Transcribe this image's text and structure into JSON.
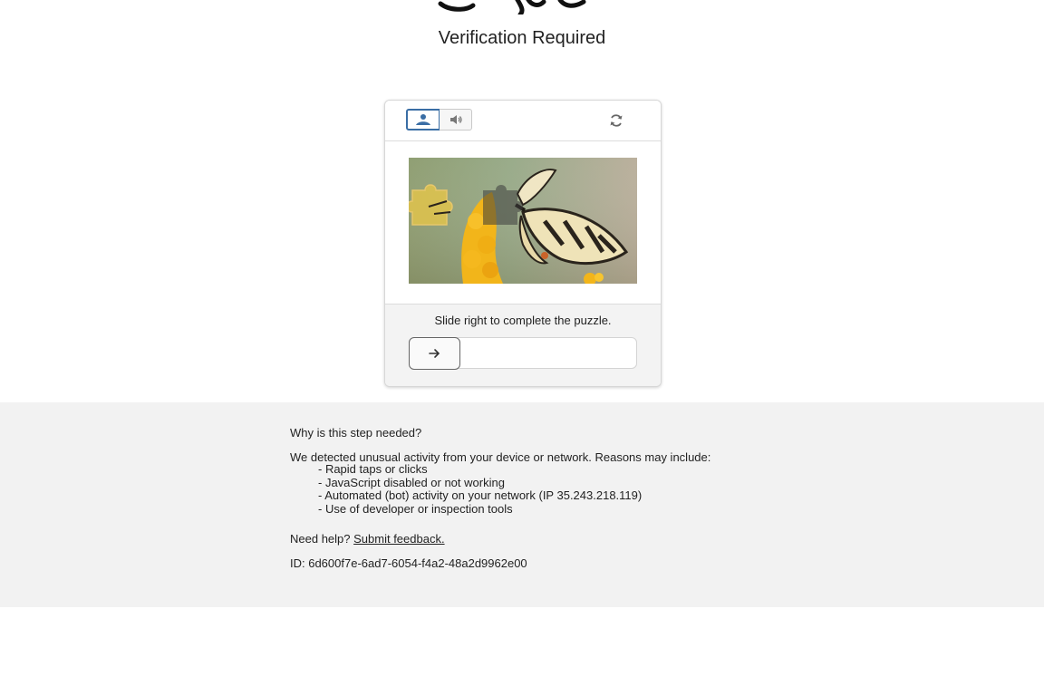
{
  "header": {
    "title": "Verification Required"
  },
  "captcha": {
    "mode_image_icon": "mountain-icon",
    "mode_audio_icon": "speaker-icon",
    "refresh_icon": "refresh-icon",
    "instruction": "Slide right to complete the puzzle.",
    "slider_icon": "arrow-right-icon",
    "slider_progress": 0,
    "accent_color": "#3a6ea5"
  },
  "info": {
    "question": "Why is this step needed?",
    "intro": "We detected unusual activity from your device or network. Reasons may include:",
    "reasons": [
      "- Rapid taps or clicks",
      "- JavaScript disabled or not working",
      "- Automated (bot) activity on your network (IP 35.243.218.119)",
      "- Use of developer or inspection tools"
    ],
    "help_prefix": "Need help?",
    "help_link": "Submit feedback.",
    "id_text": "ID: 6d600f7e-6ad7-6054-f4a2-48a2d9962e00"
  }
}
